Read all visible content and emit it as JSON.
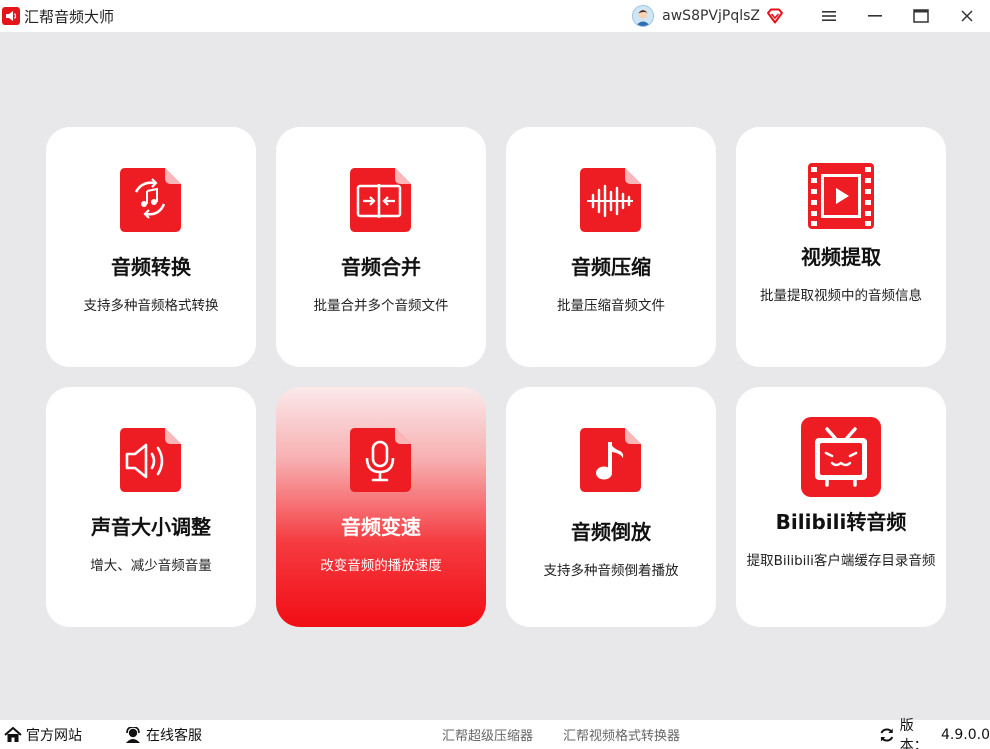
{
  "window": {
    "title": "汇帮音频大师",
    "username": "awS8PVjPqlsZ"
  },
  "colors": {
    "accent": "#e5141b",
    "background": "#e8e8eb",
    "card": "#ffffff"
  },
  "cards": [
    {
      "title": "音频转换",
      "desc": "支持多种音频格式转换",
      "icon": "audio-convert-icon"
    },
    {
      "title": "音频合并",
      "desc": "批量合并多个音频文件",
      "icon": "audio-merge-icon"
    },
    {
      "title": "音频压缩",
      "desc": "批量压缩音频文件",
      "icon": "audio-compress-icon"
    },
    {
      "title": "视频提取",
      "desc": "批量提取视频中的音频信息",
      "icon": "video-extract-icon"
    },
    {
      "title": "声音大小调整",
      "desc": "增大、减少音频音量",
      "icon": "volume-icon"
    },
    {
      "title": "音频变速",
      "desc": "改变音频的播放速度",
      "icon": "microphone-icon",
      "active": true
    },
    {
      "title": "音频倒放",
      "desc": "支持多种音频倒着播放",
      "icon": "music-note-icon"
    },
    {
      "title": "Bilibili转音频",
      "desc": "提取Bilibili客户端缓存目录音频",
      "icon": "bilibili-tv-icon"
    }
  ],
  "footer": {
    "website": "官方网站",
    "support": "在线客服",
    "link1": "汇帮超级压缩器",
    "link2": "汇帮视频格式转换器",
    "version_label": "版本：",
    "version": "4.9.0.0"
  }
}
